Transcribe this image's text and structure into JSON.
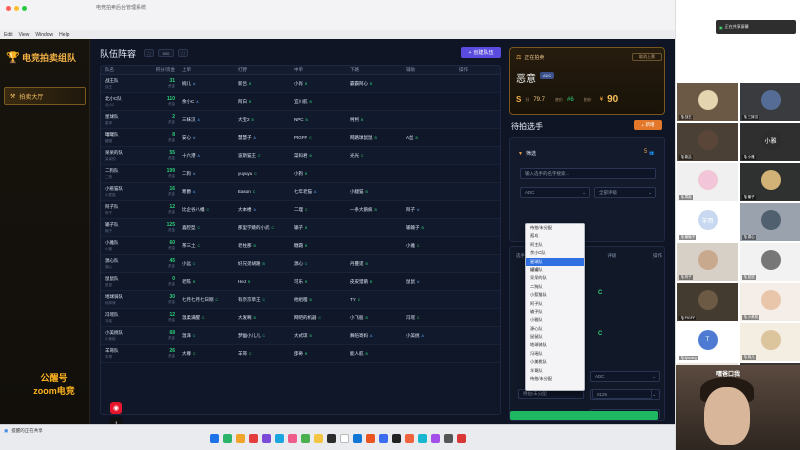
{
  "window": {
    "title": "电竞拍卖后台管理系统",
    "menu": [
      "Edit",
      "View",
      "Window",
      "Help"
    ]
  },
  "sidebar": {
    "logo": "电竞拍卖组队",
    "nav": "拍卖大厅",
    "footer1": "公醒号",
    "footer2": "zoom电竞"
  },
  "main": {
    "title": "队伍阵容",
    "ctrl_mid": "500",
    "create_label": "创建队伍",
    "headers": [
      "队名",
      "积分/资金",
      "上单",
      "打野",
      "中单",
      "下路",
      "辅助",
      "操作"
    ],
    "rows": [
      {
        "team": "战王队",
        "tsub": "战王",
        "score": "31",
        "ssub": "资金",
        "cells": [
          [
            "婉儿",
            "A"
          ],
          [
            "新吕",
            "B"
          ],
          [
            "小肖",
            "B"
          ],
          [
            "霸霸阿心",
            "B"
          ],
          [
            "",
            ""
          ]
        ]
      },
      {
        "team": "北小C队",
        "tsub": "北小C",
        "score": "110",
        "ssub": "资金",
        "cells": [
          [
            "余小C",
            "A"
          ],
          [
            "阿白",
            "B"
          ],
          [
            "宜川航",
            "B"
          ],
          [
            "",
            ""
          ],
          [
            "",
            ""
          ]
        ]
      },
      {
        "team": "星球队",
        "tsub": "星球",
        "score": "2",
        "ssub": "资金",
        "cells": [
          [
            "三妹汉",
            "A"
          ],
          [
            "大宝2",
            "B"
          ],
          [
            "NPC",
            "B"
          ],
          [
            "柯柯",
            "B"
          ],
          [
            "",
            ""
          ]
        ]
      },
      {
        "team": "罐罐队",
        "tsub": "罐罐",
        "score": "8",
        "ssub": "资金",
        "cells": [
          [
            "安心",
            "A"
          ],
          [
            "慧慧子",
            "A"
          ],
          [
            "PIGFF",
            "C"
          ],
          [
            "网路球鼠鼠",
            "B"
          ],
          [
            "A丝",
            "B"
          ]
        ]
      },
      {
        "team": "呆呆的队",
        "tsub": "呆呆的",
        "score": "55",
        "ssub": "资金",
        "cells": [
          [
            "十六港",
            "A"
          ],
          [
            "波斯猫王",
            "C"
          ],
          [
            "菜码君",
            "B"
          ],
          [
            "光光",
            "C"
          ],
          [
            "",
            ""
          ]
        ]
      },
      {
        "team": "二狗队",
        "tsub": "二狗",
        "score": "199",
        "ssub": "资金",
        "cells": [
          [
            "二狗",
            "A"
          ],
          [
            "yuyuyu",
            "C"
          ],
          [
            "小狗",
            "B"
          ],
          [
            "",
            ""
          ],
          [
            "",
            ""
          ]
        ]
      },
      {
        "team": "小惹猫队",
        "tsub": "小惹猫",
        "score": "16",
        "ssub": "资金",
        "cells": [
          [
            "寒爵",
            "A"
          ],
          [
            "Eason",
            "C"
          ],
          [
            "七年老猫",
            "A"
          ],
          [
            "小腿猫",
            "B"
          ],
          [
            "",
            ""
          ]
        ]
      },
      {
        "team": "阿子队",
        "tsub": "阿子",
        "score": "12",
        "ssub": "资金",
        "cells": [
          [
            "比企谷八幡",
            "C"
          ],
          [
            "大本楼",
            "A"
          ],
          [
            "二理",
            "C"
          ],
          [
            "一条大鹅疯",
            "B"
          ],
          [
            "阿子",
            "A"
          ]
        ]
      },
      {
        "team": "输子队",
        "tsub": "输子",
        "score": "125",
        "ssub": "资金",
        "cells": [
          [
            "喜腔型",
            "C"
          ],
          [
            "那里学跳的小武",
            "C"
          ],
          [
            "输子",
            "B"
          ],
          [
            "",
            ""
          ],
          [
            "输输子",
            "B"
          ]
        ]
      },
      {
        "team": "小雅队",
        "tsub": "小雅",
        "score": "60",
        "ssub": "资金",
        "cells": [
          [
            "茶三土",
            "C"
          ],
          [
            "老柱那",
            "B"
          ],
          [
            "糖霜",
            "B"
          ],
          [
            "",
            ""
          ],
          [
            "小雅",
            "C"
          ]
        ]
      },
      {
        "team": "源心队",
        "tsub": "源心",
        "score": "45",
        "ssub": "资金",
        "cells": [
          [
            "小远",
            "C"
          ],
          [
            "好兄弟胡路",
            "B"
          ],
          [
            "源心",
            "C"
          ],
          [
            "丹蔓诺",
            "B"
          ],
          [
            "",
            ""
          ]
        ]
      },
      {
        "team": "鼠鼠队",
        "tsub": "鼠鼠",
        "score": "0",
        "ssub": "资金",
        "cells": [
          [
            "老陈",
            "B"
          ],
          [
            "HeJ",
            "B"
          ],
          [
            "可乐",
            "B"
          ],
          [
            "皮皮猎鹅",
            "B"
          ],
          [
            "鼠鼠",
            "A"
          ]
        ]
      },
      {
        "team": "地球骑队",
        "tsub": "地球骑",
        "score": "30",
        "ssub": "资金",
        "cells": [
          [
            "七月七月七日刚",
            "C"
          ],
          [
            "有奈京草王",
            "C"
          ],
          [
            "他组哩",
            "B"
          ],
          [
            "TY",
            "C"
          ],
          [
            "",
            ""
          ]
        ]
      },
      {
        "team": "冯瑶队",
        "tsub": "冯瑶",
        "score": "12",
        "ssub": "资金",
        "cells": [
          [
            "温柔满醒",
            "C"
          ],
          [
            "大发啊",
            "B"
          ],
          [
            "网吧的机器",
            "C"
          ],
          [
            "小飞股",
            "B"
          ],
          [
            "冯瑶",
            "C"
          ]
        ]
      },
      {
        "team": "小美桃队",
        "tsub": "小美桃",
        "score": "68",
        "ssub": "资金",
        "cells": [
          [
            "温泽",
            "C"
          ],
          [
            "梦幽小儿儿",
            "C"
          ],
          [
            "大式琼",
            "B"
          ],
          [
            "舞陪寄妈",
            "A"
          ],
          [
            "小美桃",
            "A"
          ]
        ]
      },
      {
        "team": "羊哥队",
        "tsub": "羊哥",
        "score": "26",
        "ssub": "资金",
        "cells": [
          [
            "大尊",
            "C"
          ],
          [
            "羊哥",
            "C"
          ],
          [
            "邵奇",
            "B"
          ],
          [
            "能人航",
            "B"
          ],
          [
            "",
            ""
          ]
        ]
      }
    ]
  },
  "right": {
    "auction_label": "正在拍卖",
    "auction_action": "取消上票",
    "player": "恶意",
    "pos_badge": "ADC",
    "score_label": "分",
    "score_val": "79.7",
    "mid_label": "底价",
    "mid_val": "#6",
    "price_label": "拍价",
    "price_val": "90",
    "pick_title": "待拍选手",
    "add_label": "新增",
    "filter_label": "筛选",
    "filter_count": "5",
    "search_placeholder": "输入选手的名字搜索...",
    "sel1": "ADC",
    "sel2": "全部评级",
    "list_headers": [
      "选手",
      "位置",
      "评级",
      "操作"
    ],
    "form_sel": "ADC",
    "form_val1": "8",
    "form_val2": "0125",
    "dropdown": [
      "待拍/未分配",
      "孤岛",
      "阿主队",
      "余小C队",
      "星球队",
      "罐罐队",
      "呆呆的队",
      "二狗队",
      "小惹猫队",
      "阿子队",
      "输子队",
      "小雅队",
      "源心队",
      "鼠鼠队",
      "地球骑队",
      "冯瑶队",
      "小美桃队",
      "羊哥队",
      "待拍/未分配"
    ],
    "dropdown_selected": 4
  },
  "dock": {
    "left_text": "提醒的正在共享",
    "apps": [
      "#1e73e8",
      "#2db46b",
      "#f0a52a",
      "#e33d3d",
      "#7a49d8",
      "#1aa5e0",
      "#ef5d8a",
      "#4bb04f",
      "#f4c542",
      "#2c2c2c",
      "#ffffff",
      "#0f76d6",
      "#e95420",
      "#3c6df0",
      "#222222",
      "#f0623e",
      "#19b6d2",
      "#a34ee8",
      "#555555",
      "#d93636"
    ]
  },
  "zoom": {
    "top_label": "正在共享屏幕",
    "tiles": [
      {
        "name": "战王",
        "bg": "#6b5845",
        "av": "#e5d4b0",
        "t": ""
      },
      {
        "name": "三妹汉",
        "bg": "#3a3b3f",
        "av": "#556d96",
        "t": ""
      },
      {
        "name": "新吕",
        "bg": "#4a4036",
        "av": "#5a4638",
        "t": ""
      },
      {
        "name": "小雅",
        "bg": "#2f2f2f",
        "av": "#2c2c2c",
        "t": "小雅"
      },
      {
        "name": "寒爵",
        "bg": "#f0f0f0",
        "av": "#f2c6d8",
        "t": ""
      },
      {
        "name": "输子",
        "bg": "#2f3030",
        "av": "#d2b277",
        "t": ""
      },
      {
        "name": "输输子",
        "bg": "#ffffff",
        "av": "#c8d8f0",
        "t": "羊哥"
      },
      {
        "name": "源心",
        "bg": "#9aa3ad",
        "av": "#51606f",
        "t": ""
      },
      {
        "name": "阿子",
        "bg": "#d7d0c6",
        "av": "#c9a98e",
        "t": ""
      },
      {
        "name": "鼠鼠",
        "bg": "#f2f2f2",
        "av": "#777777",
        "t": ""
      },
      {
        "name": "PIGFF",
        "bg": "#433a30",
        "av": "#6d5a45",
        "t": ""
      },
      {
        "name": "小美桃",
        "bg": "#f5eee8",
        "av": "#e9c6a9",
        "t": ""
      },
      {
        "name": "tylsvsrg",
        "bg": "#ffffff",
        "av": "#4e7bd2",
        "t": "T"
      },
      {
        "name": "婉儿",
        "bg": "#f3ede2",
        "av": "#dcc49d",
        "t": ""
      },
      {
        "name": "李红",
        "bg": "#ece7e0",
        "av": "#8c6d4a",
        "t": ""
      },
      {
        "name": "二狗",
        "bg": "#3b3633",
        "av": "#7d6750",
        "t": ""
      }
    ],
    "cam_label": "嘿爸口我"
  }
}
